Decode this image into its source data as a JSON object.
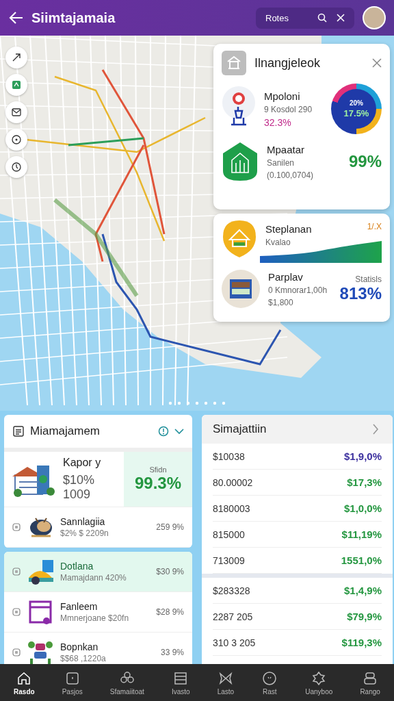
{
  "header": {
    "title": "Siimtajamaia",
    "search": {
      "value": "Rotes"
    }
  },
  "map_panel": {
    "title": "Ilnangjeleok",
    "items": [
      {
        "kind": "donut",
        "name": "Mpoloni",
        "detail": "9 Kosdol 290",
        "value": "32.3%",
        "donut_labels": [
          "20%",
          "17.5%"
        ]
      },
      {
        "kind": "plain",
        "name": "Mpaatar",
        "detail": "Sanilen",
        "extra": "(0.100,0704)",
        "value": "99%"
      }
    ]
  },
  "map_panel_2": {
    "items": [
      {
        "kind": "trend",
        "name": "Steplanan",
        "detail": "Kvalao",
        "value": "1/.X"
      },
      {
        "kind": "stat",
        "name": "Parplav",
        "detail": "0 Kmnorar1,00h",
        "extra": "$1,800",
        "label": "Statisls",
        "value": "813%"
      }
    ]
  },
  "left_panel": {
    "title": "Miamajamem",
    "featured": {
      "name": "Kapor y",
      "amount": "$10% 1009",
      "label": "Sfidn",
      "value": "99.3%"
    },
    "rows": [
      {
        "name": "Sannlagiia",
        "detail": "$2% $ 2209n",
        "value": "259 9%",
        "selected": false
      },
      {
        "name": "Dotlana",
        "detail": "Mamajdann 420%",
        "value": "$30 9%",
        "selected": true
      },
      {
        "name": "Fanleem",
        "detail": "Mmnerjoane $20fn",
        "value": "$28 9%",
        "selected": false
      },
      {
        "name": "Bopnkan",
        "detail": "$$68 ,1220a",
        "value": "33 9%",
        "selected": false
      }
    ]
  },
  "right_panel": {
    "title": "Simajattiin",
    "groups": [
      [
        {
          "amount": "$10038",
          "change": "$1,9,0%",
          "color": "#3b2f9e"
        },
        {
          "amount": "80.00002",
          "change": "$17,3%",
          "color": "#23963f"
        },
        {
          "amount": "8180003",
          "change": "$1,0,0%",
          "color": "#23963f"
        },
        {
          "amount": "815000",
          "change": "$11,19%",
          "color": "#23963f"
        },
        {
          "amount": "713009",
          "change": "1551,0%",
          "color": "#23963f"
        }
      ],
      [
        {
          "amount": "$283328",
          "change": "$1,4,9%",
          "color": "#23963f"
        },
        {
          "amount": "2287 205",
          "change": "$79,9%",
          "color": "#23963f"
        },
        {
          "amount": "310 3 205",
          "change": "$119,3%",
          "color": "#23963f"
        }
      ]
    ]
  },
  "bottom_nav": [
    {
      "label": "Rasdo",
      "selected": true
    },
    {
      "label": "Pasjos",
      "selected": false
    },
    {
      "label": "Sfamaiitoat",
      "selected": false
    },
    {
      "label": "Ivasto",
      "selected": false
    },
    {
      "label": "Lasto",
      "selected": false
    },
    {
      "label": "Rast",
      "selected": false
    },
    {
      "label": "Uanyboo",
      "selected": false
    },
    {
      "label": "Rango",
      "selected": false
    }
  ]
}
